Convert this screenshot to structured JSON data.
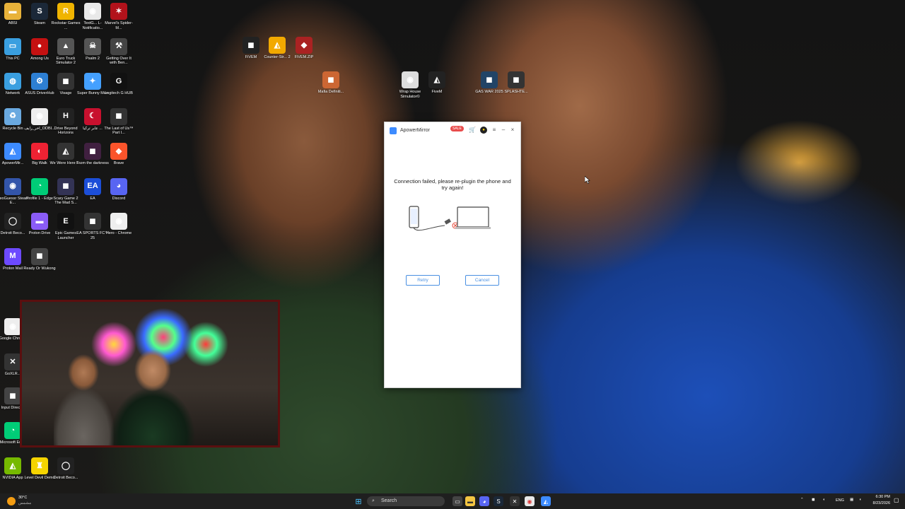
{
  "desktop": {
    "icons": [
      {
        "label": "ABSI",
        "glyph": "▬",
        "color": "#e8b23a"
      },
      {
        "label": "Steam",
        "glyph": "S",
        "color": "#1b2838"
      },
      {
        "label": "Rockstar Games ...",
        "glyph": "R",
        "color": "#f0b400"
      },
      {
        "label": "TextG... L- Notificatio...",
        "glyph": "◉",
        "color": "#e9e9e9"
      },
      {
        "label": "Marvel's Spider-M...",
        "glyph": "✶",
        "color": "#b2121b"
      },
      {
        "label": "This PC",
        "glyph": "▭",
        "color": "#3a9fe0"
      },
      {
        "label": "Among Us",
        "glyph": "●",
        "color": "#c51111"
      },
      {
        "label": "Euro Truck Simulator 2",
        "glyph": "▲",
        "color": "#555"
      },
      {
        "label": "Psalm 2",
        "glyph": "☠",
        "color": "#555"
      },
      {
        "label": "Getting Over It with Ben...",
        "glyph": "⚒",
        "color": "#444"
      },
      {
        "label": "Network",
        "glyph": "◍",
        "color": "#3a9fe0"
      },
      {
        "label": "ASUS DriverHub",
        "glyph": "⚙",
        "color": "#2d7fd3"
      },
      {
        "label": "Visage",
        "glyph": "◼",
        "color": "#333"
      },
      {
        "label": "Super Bunny Man",
        "glyph": "✦",
        "color": "#44a0ff"
      },
      {
        "label": "Logitech G HUB",
        "glyph": "G",
        "color": "#111"
      },
      {
        "label": "Recycle Bin",
        "glyph": "♻",
        "color": "#6aa9e0"
      },
      {
        "label": "اخر_رايف_ODBI...",
        "glyph": "◉",
        "color": "#eee"
      },
      {
        "label": "Drive Beyond Horizons",
        "glyph": "H",
        "color": "#222"
      },
      {
        "label": "عابر تركيا ...",
        "glyph": "☾",
        "color": "#c8102e"
      },
      {
        "label": "The Last of Us™ Part I...",
        "glyph": "◼",
        "color": "#333"
      },
      {
        "label": "ApowerMir...",
        "glyph": "◭",
        "color": "#3d8bff"
      },
      {
        "label": "Big Walk",
        "glyph": "◐",
        "color": "#e23"
      },
      {
        "label": "We Were Here T...",
        "glyph": "◭",
        "color": "#333"
      },
      {
        "label": "From the darkness",
        "glyph": "◼",
        "color": "#402040"
      },
      {
        "label": "Brave",
        "glyph": "◆",
        "color": "#fb542b"
      },
      {
        "label": "GeoGuessr Steam E...",
        "glyph": "◉",
        "color": "#35a"
      },
      {
        "label": "Profile 1 - Edge",
        "glyph": "◔",
        "color": "#0c7"
      },
      {
        "label": "Scary Game 2 The Mad S...",
        "glyph": "◼",
        "color": "#335"
      },
      {
        "label": "EA",
        "glyph": "EA",
        "color": "#1c4ed8"
      },
      {
        "label": "Discord",
        "glyph": "◕",
        "color": "#5865f2"
      },
      {
        "label": "Detroit Beco...",
        "glyph": "◯",
        "color": "#222"
      },
      {
        "label": "Proton Drive",
        "glyph": "▬",
        "color": "#8a5cf6"
      },
      {
        "label": "Epic Games Launcher",
        "glyph": "E",
        "color": "#111"
      },
      {
        "label": "EA SPORTS FC™ 25",
        "glyph": "◼",
        "color": "#333"
      },
      {
        "label": "Hero - Chrome",
        "glyph": "◉",
        "color": "#eee"
      },
      {
        "label": "Proton Mail",
        "glyph": "M",
        "color": "#6d4aff"
      },
      {
        "label": "Ready Or Wukong",
        "glyph": "◼",
        "color": "#444"
      },
      {
        "label": "Rocket League",
        "glyph": "◭",
        "color": "#2a5bd7"
      },
      {
        "label": "Forza Horizon",
        "glyph": "◼",
        "color": "#c33"
      },
      {
        "label": "Game",
        "glyph": "◼",
        "color": "#777"
      },
      {
        "label": "Google Chrome",
        "glyph": "◉",
        "color": "#eee"
      },
      {
        "label": "GoXLR...",
        "glyph": "✕",
        "color": "#333"
      },
      {
        "label": "Input Direct...",
        "glyph": "◼",
        "color": "#444"
      },
      {
        "label": "Microsoft Edge",
        "glyph": "◔",
        "color": "#0c7"
      },
      {
        "label": "NVIDIA App",
        "glyph": "◭",
        "color": "#76b900"
      },
      {
        "label": "Level Devil Demo",
        "glyph": "♜",
        "color": "#f5d400"
      },
      {
        "label": "Detroit Beco...",
        "glyph": "◯",
        "color": "#222"
      },
      {
        "label": "FiVEM",
        "glyph": "◼",
        "color": "#222"
      },
      {
        "label": "Counter-Str... 2",
        "glyph": "◭",
        "color": "#f2a900"
      },
      {
        "label": "FiVEM.ZIP",
        "glyph": "◆",
        "color": "#a22"
      },
      {
        "label": "Mafia Definiti...",
        "glyph": "◼",
        "color": "#c63"
      },
      {
        "label": "Wrap House Simulator©",
        "glyph": "◉",
        "color": "#ddd"
      },
      {
        "label": "FiveM",
        "glyph": "◭",
        "color": "#222"
      },
      {
        "label": "GAS WAR 2025",
        "glyph": "◼",
        "color": "#246"
      },
      {
        "label": "SPLASHTE...",
        "glyph": "◼",
        "color": "#333"
      }
    ]
  },
  "dialog": {
    "app_name": "ApowerMirror",
    "sale_badge": "SALE",
    "message": "Connection failed, please re-plugin the phone and try again!",
    "retry_label": "Retry",
    "cancel_label": "Cancel",
    "accent_color": "#4a90e2"
  },
  "taskbar": {
    "weather_temp": "30°C",
    "weather_desc": "مشمس",
    "search_placeholder": "Search",
    "language": "ENG",
    "time": "6:30 PM",
    "date": "8/23/2026"
  }
}
